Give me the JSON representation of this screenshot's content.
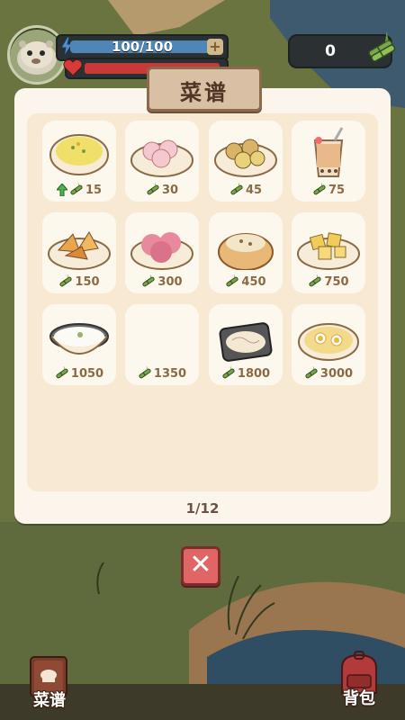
{
  "hud": {
    "energy_text": "100/100",
    "energy_fraction": 1.0,
    "hp_fraction": 1.0,
    "plus_label": "+",
    "currency_value": "0",
    "avatar_icon": "capybara-avatar-icon",
    "energy_icon": "lightning-icon",
    "hp_icon": "heart-icon",
    "currency_icon": "bamboo-bundle-icon"
  },
  "modal": {
    "title": "菜谱",
    "page_indicator": "1/12",
    "close_icon": "close-icon"
  },
  "recipes": [
    {
      "dish": "corn-soup",
      "price": "15",
      "upgrade_arrow": true
    },
    {
      "dish": "lotus-root-slices",
      "price": "30",
      "upgrade_arrow": false
    },
    {
      "dish": "potato-dumplings",
      "price": "45",
      "upgrade_arrow": false
    },
    {
      "dish": "bubble-tea",
      "price": "75",
      "upgrade_arrow": false
    },
    {
      "dish": "roasted-sweet-potato",
      "price": "150",
      "upgrade_arrow": false
    },
    {
      "dish": "pink-meat-cakes",
      "price": "300",
      "upgrade_arrow": false
    },
    {
      "dish": "bread-bowl-soup",
      "price": "450",
      "upgrade_arrow": false
    },
    {
      "dish": "fried-tofu-platter",
      "price": "750",
      "upgrade_arrow": false
    },
    {
      "dish": "rice-bowl",
      "price": "1050",
      "upgrade_arrow": false
    },
    {
      "dish": "",
      "price": "1350",
      "upgrade_arrow": false
    },
    {
      "dish": "noodle-plate",
      "price": "1800",
      "upgrade_arrow": false
    },
    {
      "dish": "egg-noodle-soup",
      "price": "3000",
      "upgrade_arrow": false
    }
  ],
  "nav": {
    "recipe_label": "菜谱",
    "bag_label": "背包"
  },
  "colors": {
    "modal_bg": "#fbf5ec",
    "inner_bg": "#f8ead2",
    "price_text": "#8a6a45",
    "close_red": "#e06565"
  }
}
